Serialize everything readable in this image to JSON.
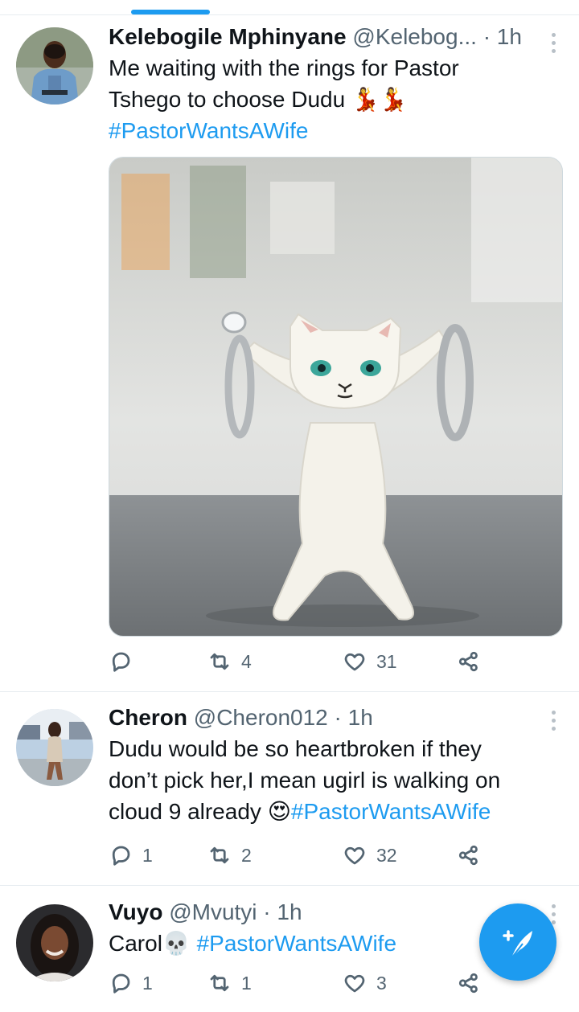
{
  "tweets": [
    {
      "name": "Kelebogile Mphinyane",
      "meta": "@Kelebog... · 1h",
      "text_lines": [
        "Me waiting with the rings for Pastor",
        "Tshego to choose Dudu"
      ],
      "emoji": "💃💃",
      "hashtag": "#PastorWantsAWife",
      "reply_count": "",
      "retweet_count": "4",
      "like_count": "31"
    },
    {
      "name": "Cheron",
      "meta": "@Cheron012 · 1h",
      "text_lines": [
        "Dudu would be so heartbroken if they",
        "don’t pick her,I mean ugirl is walking on",
        "cloud 9 already "
      ],
      "emoji": "😍",
      "hashtag": "#PastorWantsAWife",
      "reply_count": "1",
      "retweet_count": "2",
      "like_count": "32"
    },
    {
      "name": "Vuyo",
      "meta": "@Mvutyi · 1h",
      "text_lines": [
        "Carol"
      ],
      "emoji": "💀",
      "hashtag": " #PastorWantsAWife",
      "reply_count": "1",
      "retweet_count": "1",
      "like_count": "3"
    }
  ],
  "icons": {
    "reply": "reply-icon",
    "retweet": "retweet-icon",
    "like": "heart-icon",
    "share": "share-icon",
    "more": "more-vertical-icon",
    "compose": "compose-tweet-icon"
  },
  "colors": {
    "accent": "#1d9bf0",
    "text": "#0f1419",
    "secondary": "#536471"
  }
}
